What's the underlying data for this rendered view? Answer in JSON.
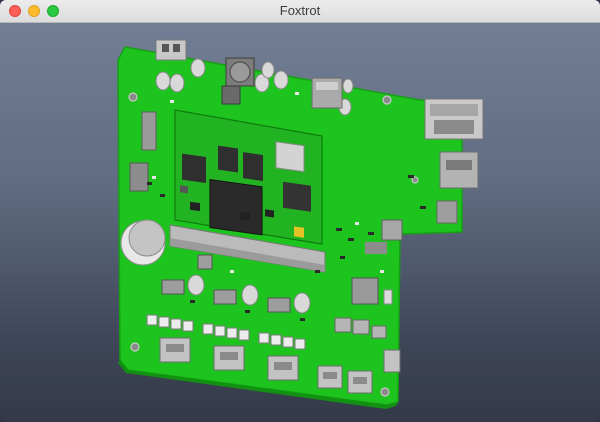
{
  "window": {
    "title": "Foxtrot"
  },
  "colors": {
    "pcb": "#1ec41e",
    "pcb_dark": "#17a317",
    "component_gray": "#bdbdbd",
    "chip_black": "#2a2a2a",
    "background_top": "#748096",
    "background_bottom": "#333947"
  },
  "icons": {
    "close": "close-icon",
    "minimize": "minimize-icon",
    "maximize": "maximize-icon"
  }
}
